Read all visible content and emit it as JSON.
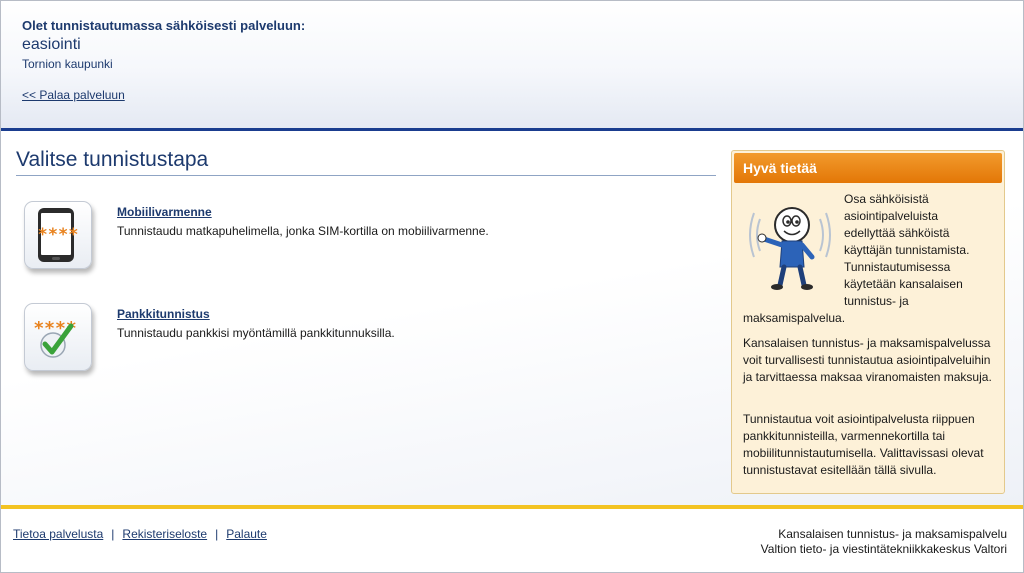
{
  "header": {
    "lead_text": "Olet tunnistautumassa sähköisesti palveluun:",
    "service_name": "easiointi",
    "organization": "Tornion kaupunki",
    "back_link": "<< Palaa palveluun"
  },
  "main": {
    "title": "Valitse tunnistustapa",
    "methods": [
      {
        "icon": "mobile-phone-icon",
        "pin_mask": "****",
        "title": "Mobiilivarmenne",
        "description": "Tunnistaudu matkapuhelimella, jonka SIM-kortilla on mobiilivarmenne."
      },
      {
        "icon": "checkmark-icon",
        "pin_mask": "****",
        "title": "Pankkitunnistus",
        "description": "Tunnistaudu pankkisi myöntämillä pankkitunnuksilla."
      }
    ]
  },
  "info_box": {
    "title": "Hyvä tietää",
    "mascot_icon": "waving-mascot-icon",
    "intro_lines": [
      "Osa sähköisistä",
      "asiointipalveluista",
      "edellyttää sähköistä",
      "käyttäjän tunnistamista.",
      "Tunnistautumisessa",
      "käytetään kansalaisen",
      "tunnistus- ja"
    ],
    "intro_tail": "maksamispalvelua.",
    "paragraph2": "Kansalaisen tunnistus- ja maksamispalvelussa voit turvallisesti tunnistautua asiointipalveluihin ja tarvittaessa maksaa viranomaisten maksuja.",
    "paragraph3": "Tunnistautua voit asiointipalvelusta riippuen pankkitunnisteilla, varmennekortilla tai mobiilitunnistautumisella. Valittavissasi olevat tunnistustavat esitellään tällä sivulla."
  },
  "footer": {
    "links": [
      "Tietoa palvelusta",
      "Rekisteriseloste",
      "Palaute"
    ],
    "separator": "|",
    "service_line": "Kansalaisen tunnistus- ja maksamispalvelu",
    "provider_line": "Valtion tieto- ja viestintätekniikkakeskus Valtori"
  },
  "colors": {
    "accent_blue": "#1a3d8f",
    "link_blue": "#1d3a6e",
    "info_orange": "#e37707",
    "footer_yellow": "#f3c322",
    "pin_orange": "#e8821e",
    "check_green": "#3aa23a"
  }
}
